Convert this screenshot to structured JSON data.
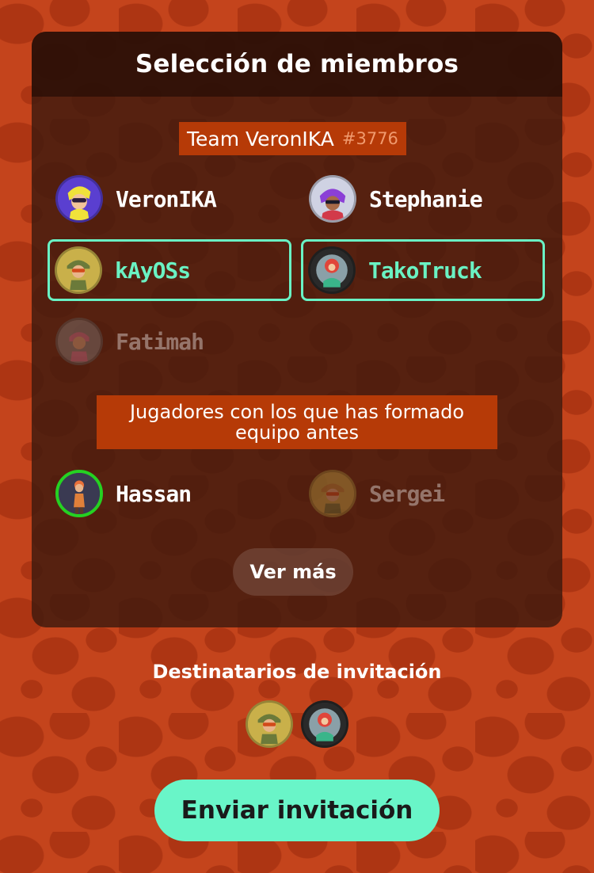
{
  "panel": {
    "title": "Selección de miembros",
    "team": {
      "name": "Team VeronIKA",
      "code": "#3776"
    }
  },
  "members": [
    {
      "name": "VeronIKA",
      "avatar_icon": "inkling-yellow-avatar-icon",
      "state": "normal"
    },
    {
      "name": "Stephanie",
      "avatar_icon": "octoling-purple-avatar-icon",
      "state": "normal"
    },
    {
      "name": "kAyOSs",
      "avatar_icon": "helmet-kid-avatar-icon",
      "state": "selected"
    },
    {
      "name": "TakoTruck",
      "avatar_icon": "octoling-red-avatar-icon",
      "state": "selected"
    },
    {
      "name": "Fatimah",
      "avatar_icon": "inkling-pink-avatar-icon",
      "state": "unavailable"
    }
  ],
  "recent": {
    "label": "Jugadores con los que has formado equipo antes",
    "players": [
      {
        "name": "Hassan",
        "avatar_icon": "inkling-orange-avatar-icon",
        "state": "online"
      },
      {
        "name": "Sergei",
        "avatar_icon": "helmet-kid-avatar-icon",
        "state": "unavailable"
      }
    ]
  },
  "more_button": "Ver más",
  "recipients": {
    "title": "Destinatarios de invitación",
    "avatars": [
      "helmet-kid-avatar-icon",
      "octoling-red-avatar-icon"
    ]
  },
  "send_button": "Enviar invitación",
  "colors": {
    "background": "#c4441c",
    "accent": "#69f5c8",
    "tag": "#b63a07",
    "online": "#25d122"
  }
}
